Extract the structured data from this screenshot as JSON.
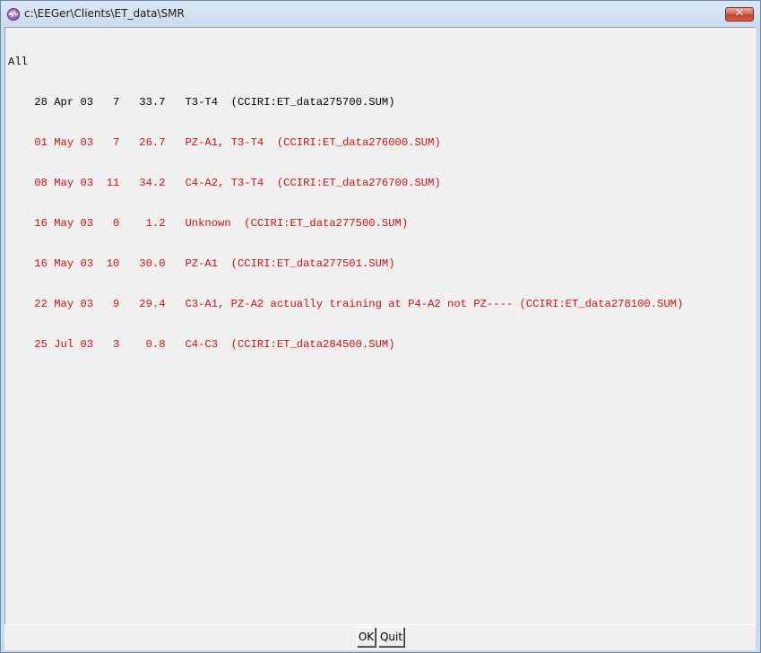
{
  "window": {
    "title": "c:\\EEGer\\Clients\\ET_data\\SMR",
    "close_label": "✕"
  },
  "header": "All",
  "records": [
    {
      "text": "    28 Apr 03   7   33.7   T3-T4  (CCIRI:ET_data275700.SUM)",
      "color": "black"
    },
    {
      "text": "    01 May 03   7   26.7   PZ-A1, T3-T4  (CCIRI:ET_data276000.SUM)",
      "color": "red"
    },
    {
      "text": "    08 May 03  11   34.2   C4-A2, T3-T4  (CCIRI:ET_data276700.SUM)",
      "color": "red"
    },
    {
      "text": "    16 May 03   0    1.2   Unknown  (CCIRI:ET_data277500.SUM)",
      "color": "red"
    },
    {
      "text": "    16 May 03  10   30.0   PZ-A1  (CCIRI:ET_data277501.SUM)",
      "color": "red"
    },
    {
      "text": "    22 May 03   9   29.4   C3-A1, PZ-A2 actually training at P4-A2 not PZ---- (CCIRI:ET_data278100.SUM)",
      "color": "red"
    },
    {
      "text": "    25 Jul 03   3    0.8   C4-C3  (CCIRI:ET_data284500.SUM)",
      "color": "red"
    }
  ],
  "buttons": {
    "ok": "OK",
    "quit": "Quit"
  },
  "colors": {
    "normal_text": "#000000",
    "highlight_text": "#d01010",
    "background": "#f0f0f0"
  }
}
